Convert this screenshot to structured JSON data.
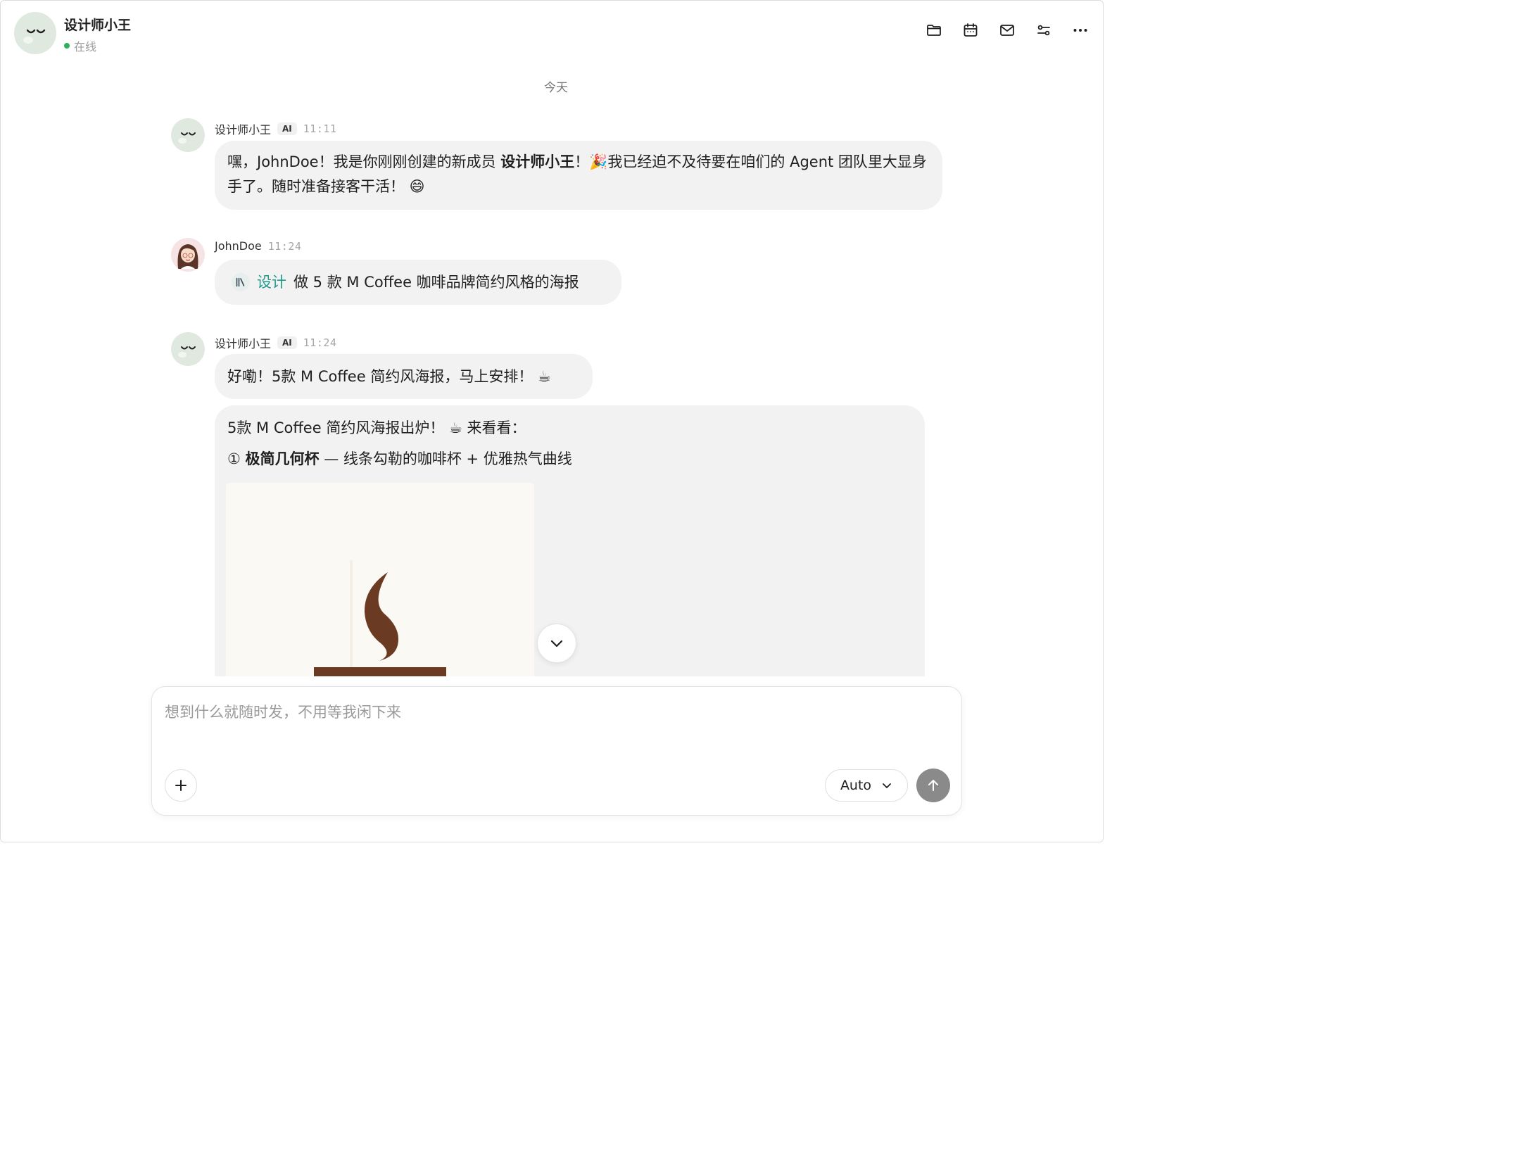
{
  "header": {
    "agent_name": "设计师小王",
    "status": "在线",
    "icons": [
      "folder-icon",
      "calendar-icon",
      "mail-icon",
      "settings-sliders-icon",
      "more-icon"
    ]
  },
  "date_separator": "今天",
  "messages": [
    {
      "sender": "设计师小王",
      "badge": "AI",
      "time": "11:11",
      "text_before": "嘿，JohnDoe！我是你刚刚创建的新成员 ",
      "text_bold": "设计师小王",
      "text_after": "！🎉我已经迫不及待要在咱们的 Agent 团队里大显身手了。随时准备接客干活！ 😄"
    },
    {
      "sender": "JohnDoe",
      "time": "11:24",
      "chip_label": "设计",
      "text": "做 5 款 M Coffee 咖啡品牌简约风格的海报"
    },
    {
      "sender": "设计师小王",
      "badge": "AI",
      "time": "11:24",
      "text": "好嘞！5款 M Coffee 简约风海报，马上安排！ ☕"
    },
    {
      "line1": "5款 M Coffee 简约风海报出炉！ ☕ 来看看：",
      "line2_marker": "①",
      "line2_bold": "极简几何杯",
      "line2_rest": " — 线条勾勒的咖啡杯 + 优雅热气曲线"
    }
  ],
  "composer": {
    "placeholder": "想到什么就随时发，不用等我闲下来",
    "mode": "Auto"
  },
  "colors": {
    "online": "#2fb15c",
    "chip_accent": "#1f9a8c",
    "bubble": "#f2f2f2",
    "coffee_brown": "#6b3a22"
  }
}
